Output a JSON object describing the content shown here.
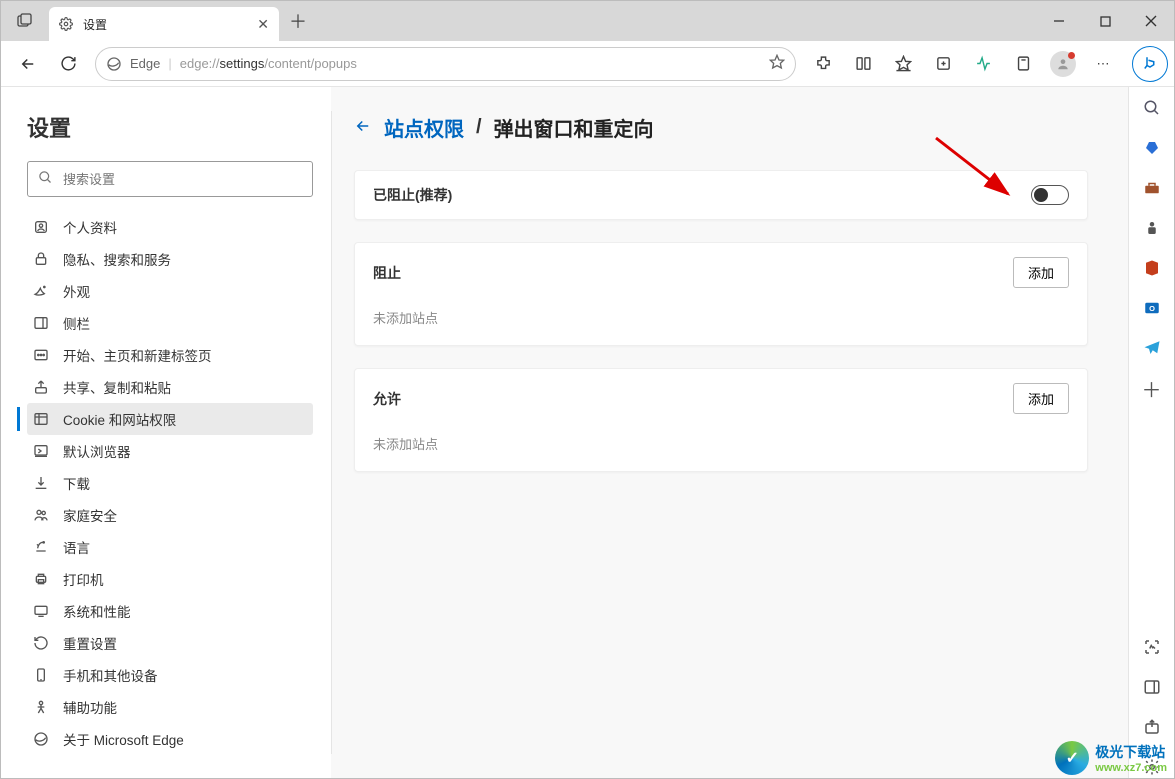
{
  "window": {
    "tab_title": "设置",
    "edge_label": "Edge",
    "url_prefix": "edge://",
    "url_bold": "settings",
    "url_suffix": "/content/popups"
  },
  "settings": {
    "heading": "设置",
    "search_placeholder": "搜索设置",
    "nav": [
      "个人资料",
      "隐私、搜索和服务",
      "外观",
      "侧栏",
      "开始、主页和新建标签页",
      "共享、复制和粘贴",
      "Cookie 和网站权限",
      "默认浏览器",
      "下载",
      "家庭安全",
      "语言",
      "打印机",
      "系统和性能",
      "重置设置",
      "手机和其他设备",
      "辅助功能",
      "关于 Microsoft Edge"
    ],
    "nav_active_index": 6
  },
  "breadcrumb": {
    "link": "站点权限",
    "sep": "/",
    "current": "弹出窗口和重定向"
  },
  "cards": {
    "blocked_toggle_label": "已阻止(推荐)",
    "blocked_toggle_on": false,
    "block_section": "阻止",
    "allow_section": "允许",
    "add_button": "添加",
    "empty_text": "未添加站点"
  },
  "watermark": {
    "name": "极光下载站",
    "url": "www.xz7.com"
  }
}
